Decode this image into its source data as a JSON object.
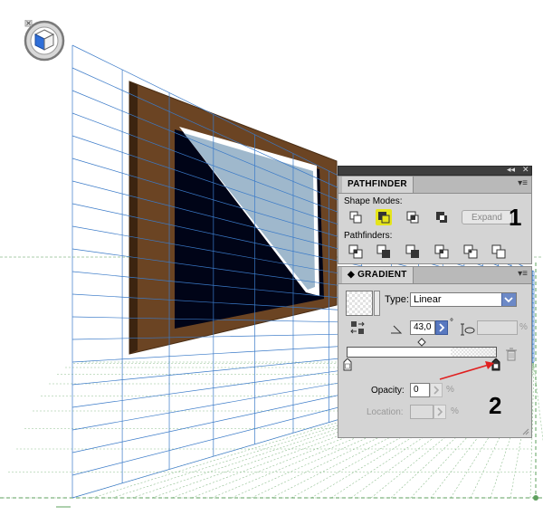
{
  "canvas": {
    "widget_icon": "perspective-grid-widget-icon"
  },
  "dock": {
    "collapse_icon": "double-arrow-icon",
    "menu_icon": "panel-menu-icon"
  },
  "pathfinder": {
    "tab_label": "PATHFINDER",
    "shape_modes_label": "Shape Modes:",
    "pathfinders_label": "Pathfinders:",
    "expand_label": "Expand",
    "callout_number": "1",
    "highlight_color": "#e5e51a"
  },
  "gradient": {
    "tab_label": "GRADIENT",
    "type_label": "Type:",
    "type_value": "Linear",
    "angle_value": "43,0",
    "degree_symbol": "°",
    "aspect_value": "",
    "aspect_unit": "%",
    "opacity_label": "Opacity:",
    "opacity_value": "0",
    "opacity_unit": "%",
    "location_label": "Location:",
    "location_value": "",
    "location_unit": "%",
    "callout_number": "2",
    "arrow_color": "#e02020"
  }
}
